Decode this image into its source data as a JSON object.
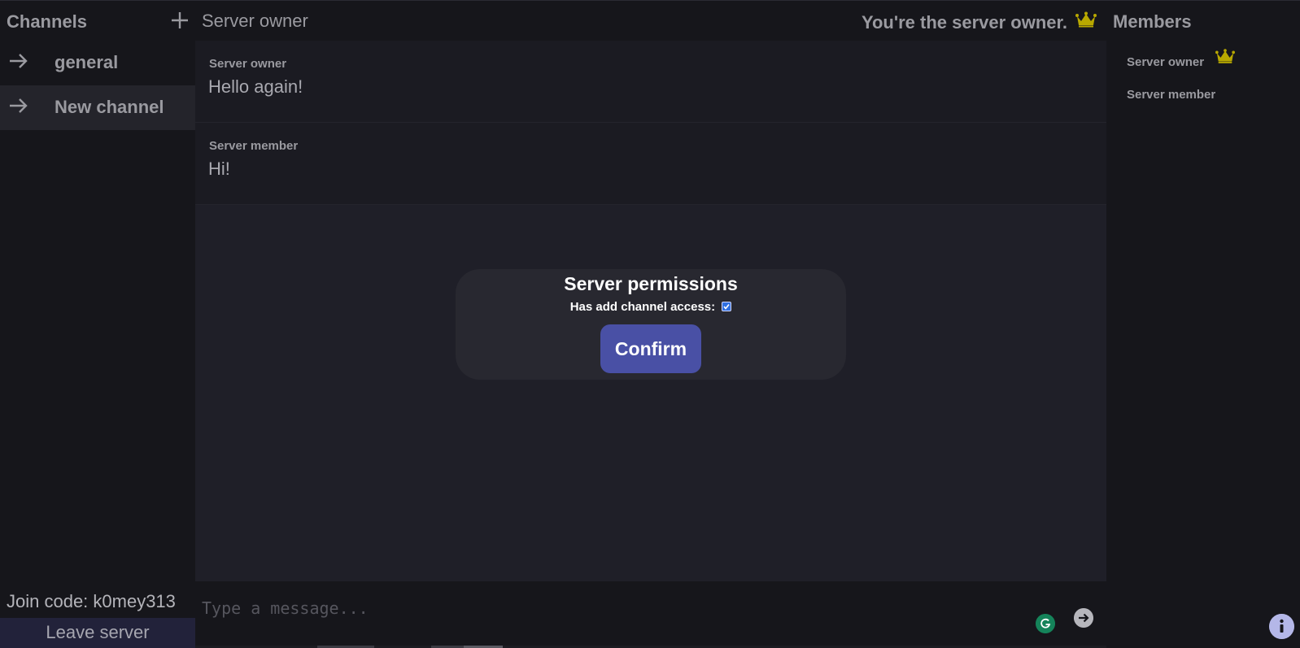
{
  "sidebar": {
    "title": "Channels",
    "add_icon": "plus-icon",
    "channels": [
      {
        "label": "general",
        "icon": "arrow-right-icon",
        "active": false
      },
      {
        "label": "New channel",
        "icon": "arrow-right-icon",
        "active": true
      }
    ],
    "join_code": "Join code: k0mey313",
    "leave_label": "Leave server"
  },
  "header": {
    "server_name": "Server owner",
    "owner_note": "You're the server owner.",
    "crown_icon": "crown-icon"
  },
  "messages": [
    {
      "author": "Server owner",
      "text": "Hello again!"
    },
    {
      "author": "Server member",
      "text": "Hi!"
    }
  ],
  "modal": {
    "title": "Server permissions",
    "permission_label": "Has add channel access:",
    "permission_checked": true,
    "confirm_label": "Confirm"
  },
  "composer": {
    "placeholder": "Type a message...",
    "grammar_icon": "grammarly-icon",
    "send_icon": "send-arrow-icon"
  },
  "members": {
    "title": "Members",
    "list": [
      {
        "name": "Server owner",
        "owner": true
      },
      {
        "name": "Server member",
        "owner": false
      }
    ]
  },
  "colors": {
    "accent": "#4950a5",
    "crown": "#b8a800",
    "background": "#16161b",
    "panel": "#1f1f28"
  },
  "info_icon": "info-icon"
}
